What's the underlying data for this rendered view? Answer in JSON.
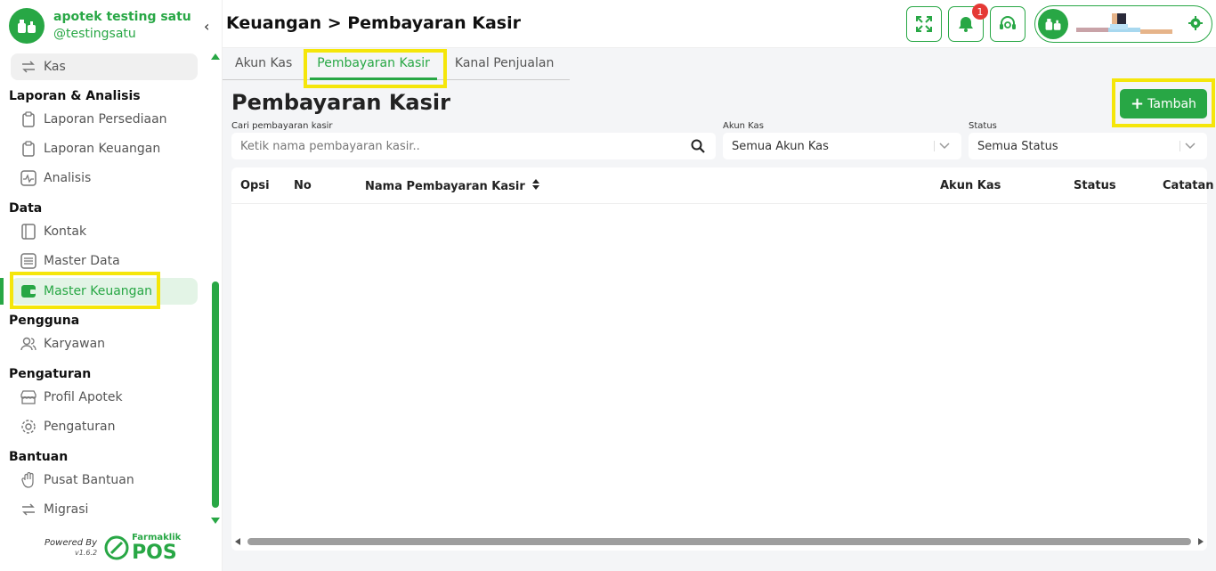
{
  "brand": {
    "name": "apotek testing satu",
    "handle": "@testingsatu"
  },
  "sidebar": {
    "kas_label": "Kas",
    "sections": {
      "laporan": "Laporan & Analisis",
      "data": "Data",
      "pengguna": "Pengguna",
      "pengaturan": "Pengaturan",
      "bantuan": "Bantuan"
    },
    "items": {
      "laporan_persediaan": "Laporan Persediaan",
      "laporan_keuangan": "Laporan Keuangan",
      "analisis": "Analisis",
      "kontak": "Kontak",
      "master_data": "Master Data",
      "master_keuangan": "Master Keuangan",
      "karyawan": "Karyawan",
      "profil_apotek": "Profil Apotek",
      "pengaturan": "Pengaturan",
      "pusat_bantuan": "Pusat Bantuan",
      "migrasi": "Migrasi"
    },
    "powered_by": "Powered By",
    "version": "v1.6.2",
    "logo_small": "Farmaklik",
    "logo_big": "POS"
  },
  "header": {
    "breadcrumb": "Keuangan > Pembayaran Kasir",
    "notification_count": "1"
  },
  "tabs": [
    "Akun Kas",
    "Pembayaran Kasir",
    "Kanal Penjualan"
  ],
  "main": {
    "title": "Pembayaran Kasir",
    "add_label": "Tambah",
    "search_label": "Cari pembayaran kasir",
    "search_placeholder": "Ketik nama pembayaran kasir..",
    "akun_label": "Akun Kas",
    "akun_value": "Semua Akun Kas",
    "status_label": "Status",
    "status_value": "Semua Status"
  },
  "table": {
    "columns": [
      "Opsi",
      "No",
      "Nama Pembayaran Kasir",
      "Akun Kas",
      "Status",
      "Catatan"
    ]
  },
  "colors": {
    "accent": "#28a745",
    "highlight": "#f5e60a",
    "badge": "#e53935"
  }
}
